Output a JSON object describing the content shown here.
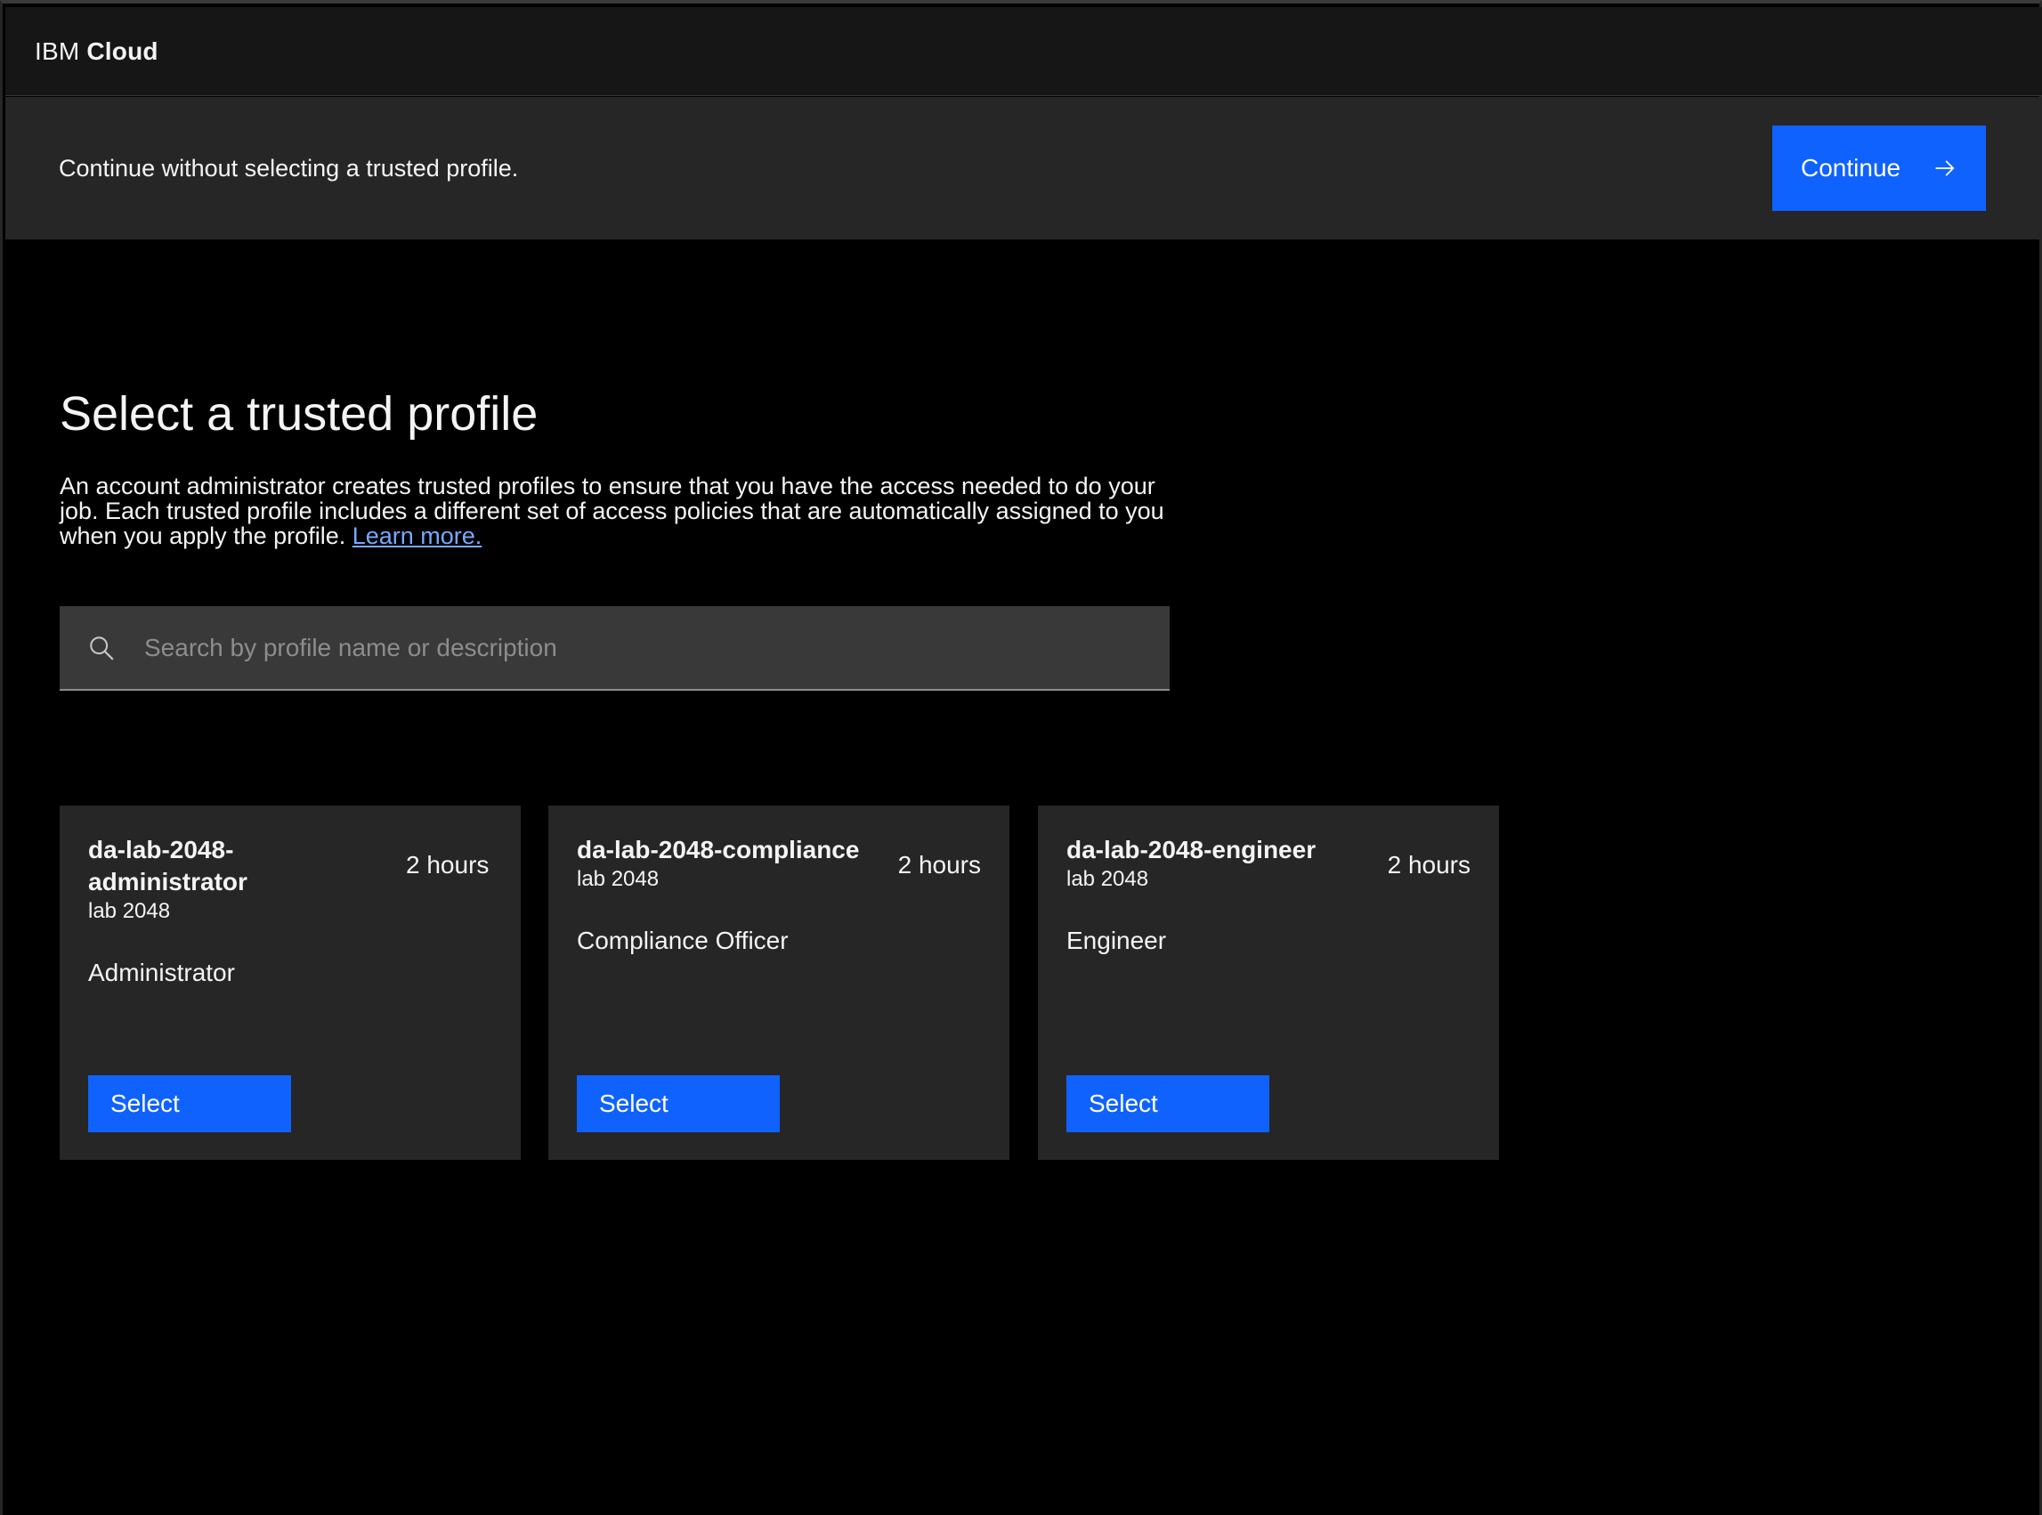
{
  "header": {
    "brand_company": "IBM",
    "brand_product": "Cloud"
  },
  "banner": {
    "text": "Continue without selecting a trusted profile.",
    "continue_label": "Continue",
    "continue_icon": "arrow-right-icon"
  },
  "main": {
    "title": "Select a trusted profile",
    "description": "An account administrator creates trusted profiles to ensure that you have the access needed to do your job. Each trusted profile includes a different set of access policies that are automatically assigned to you when you apply the profile.",
    "learn_more_label": "Learn more.",
    "search": {
      "placeholder": "Search by profile name or description",
      "value": "",
      "icon": "search-icon"
    }
  },
  "profiles": [
    {
      "name": "da-lab-2048-administrator",
      "duration": "2 hours",
      "subtitle": "lab 2048",
      "role": "Administrator",
      "select_label": "Select"
    },
    {
      "name": "da-lab-2048-compliance",
      "duration": "2 hours",
      "subtitle": "lab 2048",
      "role": "Compliance Officer",
      "select_label": "Select"
    },
    {
      "name": "da-lab-2048-engineer",
      "duration": "2 hours",
      "subtitle": "lab 2048",
      "role": "Engineer",
      "select_label": "Select"
    }
  ],
  "colors": {
    "accent": "#0f62fe",
    "link": "#78a9ff",
    "card_bg": "#262626",
    "header_bg": "#161616",
    "page_bg": "#000000"
  }
}
